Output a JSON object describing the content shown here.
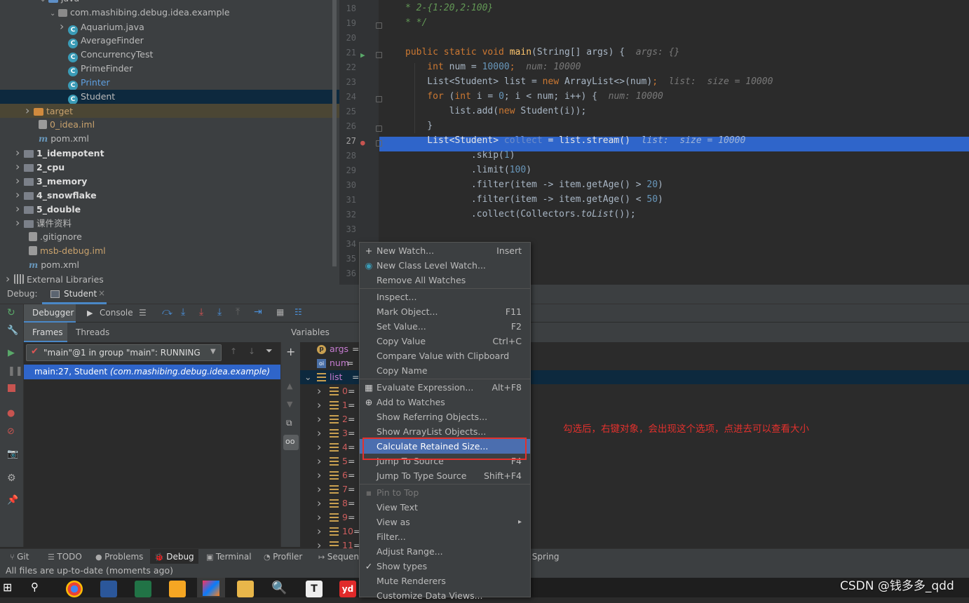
{
  "project_tree": {
    "items": [
      {
        "label": "java",
        "indent": 7,
        "arrow": "v",
        "icon": "folder-blue-icon"
      },
      {
        "label": "com.mashibing.debug.idea.example",
        "indent": 9,
        "arrow": "v",
        "icon": "package-icon"
      },
      {
        "label": "Aquarium.java",
        "indent": 11,
        "arrow": ">",
        "icon": "java-class-icon"
      },
      {
        "label": "AverageFinder",
        "indent": 11,
        "arrow": "",
        "icon": "java-class-icon"
      },
      {
        "label": "ConcurrencyTest",
        "indent": 11,
        "arrow": "",
        "icon": "java-class-icon"
      },
      {
        "label": "PrimeFinder",
        "indent": 11,
        "arrow": "",
        "icon": "java-class-icon"
      },
      {
        "label": "Printer",
        "indent": 11,
        "arrow": "",
        "icon": "java-class-icon",
        "color": "blue"
      },
      {
        "label": "Student",
        "indent": 11,
        "arrow": "",
        "icon": "java-class-icon",
        "selected": true
      },
      {
        "label": "target",
        "indent": 4,
        "arrow": ">",
        "icon": "folder-orange-icon",
        "color": "orange",
        "excluded": true
      },
      {
        "label": "0_idea.iml",
        "indent": 5,
        "arrow": "",
        "icon": "iml-file-icon",
        "color": "orange"
      },
      {
        "label": "pom.xml",
        "indent": 5,
        "arrow": "",
        "icon": "maven-icon"
      },
      {
        "label": "1_idempotent",
        "indent": 2,
        "arrow": ">",
        "icon": "module-folder-icon",
        "bold": true
      },
      {
        "label": "2_cpu",
        "indent": 2,
        "arrow": ">",
        "icon": "module-folder-icon",
        "bold": true
      },
      {
        "label": "3_memory",
        "indent": 2,
        "arrow": ">",
        "icon": "module-folder-icon",
        "bold": true
      },
      {
        "label": "4_snowflake",
        "indent": 2,
        "arrow": ">",
        "icon": "module-folder-icon",
        "bold": true
      },
      {
        "label": "5_double",
        "indent": 2,
        "arrow": ">",
        "icon": "module-folder-icon",
        "bold": true
      },
      {
        "label": "课件资料",
        "indent": 2,
        "arrow": ">",
        "icon": "folder-icon"
      },
      {
        "label": ".gitignore",
        "indent": 3,
        "arrow": "",
        "icon": "git-file-icon"
      },
      {
        "label": "msb-debug.iml",
        "indent": 3,
        "arrow": "",
        "icon": "iml-file-icon",
        "color": "orange"
      },
      {
        "label": "pom.xml",
        "indent": 3,
        "arrow": "",
        "icon": "maven-icon"
      },
      {
        "label": "External Libraries",
        "indent": 0,
        "arrow": ">",
        "icon": "library-icon"
      }
    ]
  },
  "editor": {
    "current_line": "27",
    "lines": [
      {
        "num": "18",
        "text": "* 2-{1:20,2:100}"
      },
      {
        "num": "19",
        "text": "* */"
      },
      {
        "num": "20",
        "text": ""
      },
      {
        "num": "21",
        "text": "public static void main(String[] args) {   args: {}"
      },
      {
        "num": "22",
        "text": "int num = 10000;   num: 10000"
      },
      {
        "num": "23",
        "text": "List<Student> list = new ArrayList<>(num);   list:  size = 10000"
      },
      {
        "num": "24",
        "text": "for (int i = 0; i < num; i++) {   num: 10000"
      },
      {
        "num": "25",
        "text": "list.add(new Student(i));"
      },
      {
        "num": "26",
        "text": "}"
      },
      {
        "num": "27",
        "text": "List<Student> collect = list.stream()   list:  size = 10000"
      },
      {
        "num": "28",
        "text": ".skip(1)"
      },
      {
        "num": "29",
        "text": ".limit(100)"
      },
      {
        "num": "30",
        "text": ".filter(item -> item.getAge() > 20)"
      },
      {
        "num": "31",
        "text": ".filter(item -> item.getAge() < 50)"
      },
      {
        "num": "32",
        "text": ".collect(Collectors.toList());"
      },
      {
        "num": "33",
        "text": ""
      },
      {
        "num": "34",
        "text": ""
      },
      {
        "num": "35",
        "text": ""
      },
      {
        "num": "36",
        "text": ""
      }
    ]
  },
  "debug": {
    "label": "Debug:",
    "session_tab": "Student",
    "tabs": {
      "debugger": "Debugger",
      "console": "Console"
    },
    "frames_tab": "Frames",
    "threads_tab": "Threads",
    "thread_select": "\"main\"@1 in group \"main\": RUNNING",
    "frame_location": "main:27, Student",
    "frame_package": "(com.mashibing.debug.idea.example)",
    "variables_header": "Variables",
    "variables": [
      {
        "name": "args",
        "suffix": " =",
        "icon": "p"
      },
      {
        "name": "num",
        "suffix": " =",
        "icon": "o"
      },
      {
        "name": "list",
        "suffix": " = {A",
        "icon": "list",
        "expanded": true,
        "selected": true
      },
      {
        "name": "0",
        "suffix": " =",
        "icon": "list",
        "child": true
      },
      {
        "name": "1",
        "suffix": " =",
        "icon": "list",
        "child": true
      },
      {
        "name": "2",
        "suffix": " =",
        "icon": "list",
        "child": true
      },
      {
        "name": "3",
        "suffix": " =",
        "icon": "list",
        "child": true
      },
      {
        "name": "4",
        "suffix": " =",
        "icon": "list",
        "child": true
      },
      {
        "name": "5",
        "suffix": " =",
        "icon": "list",
        "child": true
      },
      {
        "name": "6",
        "suffix": " =",
        "icon": "list",
        "child": true
      },
      {
        "name": "7",
        "suffix": " =",
        "icon": "list",
        "child": true
      },
      {
        "name": "8",
        "suffix": " =",
        "icon": "list",
        "child": true
      },
      {
        "name": "9",
        "suffix": " =",
        "icon": "list",
        "child": true
      },
      {
        "name": "10",
        "suffix": " =",
        "icon": "list",
        "child": true
      },
      {
        "name": "11",
        "suffix": " =",
        "icon": "list",
        "child": true
      }
    ]
  },
  "context_menu": {
    "items": [
      {
        "label": "New Watch...",
        "shortcut": "Insert",
        "icon": "+"
      },
      {
        "label": "New Class Level Watch...",
        "shortcut": "",
        "icon": "class-watch"
      },
      {
        "label": "Remove All Watches",
        "shortcut": ""
      },
      {
        "sep": true
      },
      {
        "label": "Inspect...",
        "shortcut": ""
      },
      {
        "label": "Mark Object...",
        "shortcut": "F11"
      },
      {
        "label": "Set Value...",
        "shortcut": "F2"
      },
      {
        "label": "Copy Value",
        "shortcut": "Ctrl+C"
      },
      {
        "label": "Compare Value with Clipboard",
        "shortcut": ""
      },
      {
        "label": "Copy Name",
        "shortcut": ""
      },
      {
        "sep": true
      },
      {
        "label": "Evaluate Expression...",
        "shortcut": "Alt+F8",
        "icon": "calc"
      },
      {
        "label": "Add to Watches",
        "shortcut": "",
        "icon": "watch"
      },
      {
        "label": "Show Referring Objects...",
        "shortcut": ""
      },
      {
        "label": "Show ArrayList Objects...",
        "shortcut": ""
      },
      {
        "label": "Calculate Retained Size...",
        "shortcut": "",
        "highlighted": true
      },
      {
        "label": "Jump To Source",
        "shortcut": "F4"
      },
      {
        "label": "Jump To Type Source",
        "shortcut": "Shift+F4"
      },
      {
        "sep": true
      },
      {
        "label": "Pin to Top",
        "shortcut": "",
        "disabled": true,
        "icon": "pin"
      },
      {
        "label": "View Text",
        "shortcut": ""
      },
      {
        "label": "View as",
        "shortcut": "▸"
      },
      {
        "label": "Filter...",
        "shortcut": ""
      },
      {
        "label": "Adjust Range...",
        "shortcut": ""
      },
      {
        "label": "Show types",
        "shortcut": "",
        "icon": "check"
      },
      {
        "label": "Mute Renderers",
        "shortcut": ""
      },
      {
        "label": "Customize Data Views...",
        "shortcut": ""
      }
    ]
  },
  "annotation": "勾选后，右键对象，会出现这个选项，点进去可以查看大小",
  "bottom_tabs": [
    {
      "label": "Git",
      "icon": "git-branch-icon"
    },
    {
      "label": "TODO",
      "icon": "todo-icon"
    },
    {
      "label": "Problems",
      "icon": "problems-icon"
    },
    {
      "label": "Debug",
      "icon": "bug-icon",
      "active": true
    },
    {
      "label": "Terminal",
      "icon": "terminal-icon"
    },
    {
      "label": "Profiler",
      "icon": "profiler-icon"
    },
    {
      "label": "Sequenc",
      "icon": "sequence-icon"
    },
    {
      "label": "Spring",
      "icon": "spring-icon"
    }
  ],
  "status_text": "All files are up-to-date (moments ago)",
  "watermark": "CSDN @钱多多_qdd",
  "colors": {
    "accent": "#2f65ca",
    "menu_highlight": "#4b6eaf",
    "annotation_red": "#e3312d"
  }
}
